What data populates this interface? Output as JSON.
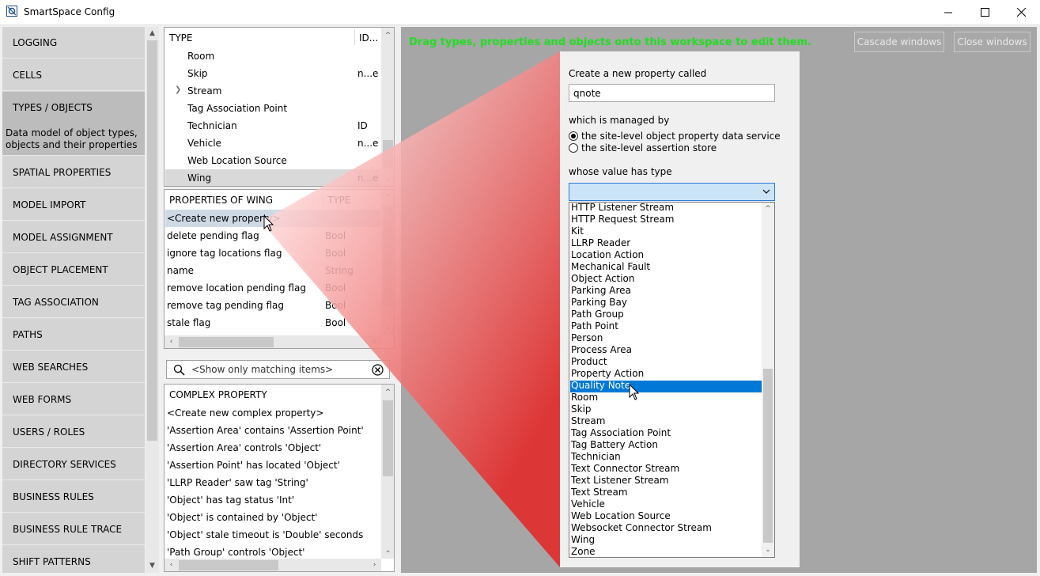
{
  "window": {
    "title": "SmartSpace Config"
  },
  "nav": {
    "items": [
      {
        "label": "LOGGING"
      },
      {
        "label": "CELLS"
      },
      {
        "label": "TYPES / OBJECTS",
        "desc": "Data model of object types, objects and their properties"
      },
      {
        "label": "SPATIAL PROPERTIES"
      },
      {
        "label": "MODEL IMPORT"
      },
      {
        "label": "MODEL ASSIGNMENT"
      },
      {
        "label": "OBJECT PLACEMENT"
      },
      {
        "label": "TAG ASSOCIATION"
      },
      {
        "label": "PATHS"
      },
      {
        "label": "WEB SEARCHES"
      },
      {
        "label": "WEB FORMS"
      },
      {
        "label": "USERS / ROLES"
      },
      {
        "label": "DIRECTORY SERVICES"
      },
      {
        "label": "BUSINESS RULES"
      },
      {
        "label": "BUSINESS RULE TRACE"
      },
      {
        "label": "SHIFT PATTERNS"
      }
    ]
  },
  "types_panel": {
    "col_type": "TYPE",
    "col_id": "ID...",
    "rows": [
      {
        "name": "Room",
        "id": ""
      },
      {
        "name": "Skip",
        "id": "n...e"
      },
      {
        "name": "Stream",
        "id": ""
      },
      {
        "name": "Tag Association Point",
        "id": ""
      },
      {
        "name": "Technician",
        "id": "ID"
      },
      {
        "name": "Vehicle",
        "id": "n...e"
      },
      {
        "name": "Web Location Source",
        "id": ""
      },
      {
        "name": "Wing",
        "id": "n...e"
      }
    ]
  },
  "props_panel": {
    "col_props": "PROPERTIES OF WING",
    "col_type": "TYPE",
    "rows": [
      {
        "name": "<Create new property>",
        "type": ""
      },
      {
        "name": "delete pending flag",
        "type": "Bool"
      },
      {
        "name": "ignore tag locations flag",
        "type": "Bool"
      },
      {
        "name": "name",
        "type": "String"
      },
      {
        "name": "remove location pending flag",
        "type": "Bool"
      },
      {
        "name": "remove tag pending flag",
        "type": "Bool"
      },
      {
        "name": "stale flag",
        "type": "Bool"
      }
    ]
  },
  "search": {
    "placeholder": "<Show only matching items>"
  },
  "complex_panel": {
    "header": "COMPLEX PROPERTY",
    "rows": [
      "<Create new complex property>",
      "'Assertion Area' contains 'Assertion Point'",
      "'Assertion Area' controls 'Object'",
      "'Assertion Point' has located 'Object'",
      "'LLRP Reader' saw tag 'String'",
      "'Object' has tag status 'Int'",
      "'Object' is contained by 'Object'",
      "'Object' stale timeout is 'Double' seconds",
      "'Path Group' controls 'Object'"
    ]
  },
  "workspace": {
    "hint": "Drag types, properties and objects onto this workspace to edit them.",
    "cascade_label": "Cascade windows",
    "close_label": "Close windows",
    "hint_color": "#22dd22"
  },
  "form": {
    "create_label": "Create a new property called",
    "name_value": "qnote",
    "managed_label": "which is managed by",
    "radio1": "the site-level object property data service",
    "radio2": "the site-level assertion store",
    "value_type_label": "whose value has type",
    "selected_option": "Quality Note",
    "options": [
      "HTTP Listener Stream",
      "HTTP Request Stream",
      "Kit",
      "LLRP Reader",
      "Location Action",
      "Mechanical Fault",
      "Object Action",
      "Parking Area",
      "Parking Bay",
      "Path Group",
      "Path Point",
      "Person",
      "Process Area",
      "Product",
      "Property Action",
      "Quality Note",
      "Room",
      "Skip",
      "Stream",
      "Tag Association Point",
      "Tag Battery Action",
      "Technician",
      "Text Connector Stream",
      "Text Listener Stream",
      "Text Stream",
      "Vehicle",
      "Web Location Source",
      "Websocket Connector Stream",
      "Wing",
      "Zone"
    ]
  }
}
